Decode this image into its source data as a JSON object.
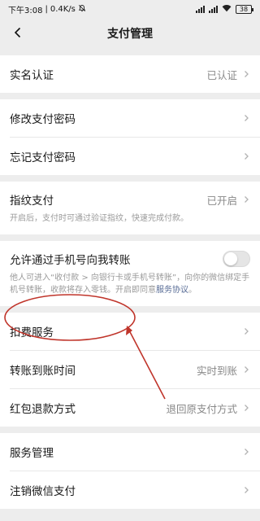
{
  "status_bar": {
    "time": "下午3:08",
    "net_speed": "0.4K/s",
    "battery": "38"
  },
  "nav": {
    "title": "支付管理"
  },
  "rows": {
    "real_name": {
      "label": "实名认证",
      "value": "已认证"
    },
    "change_pwd": {
      "label": "修改支付密码"
    },
    "forgot_pwd": {
      "label": "忘记支付密码"
    },
    "fingerprint": {
      "label": "指纹支付",
      "value": "已开启",
      "desc": "开启后，支付时可通过验证指纹，快速完成付款。"
    },
    "allow_transfer": {
      "label": "允许通过手机号向我转账",
      "desc": "他人可进入“收付款 > 向银行卡或手机号转账”，向你的微信绑定手机号转账，收款将存入零钱。开启即同意",
      "desc_link": "服务协议",
      "desc_end": "。",
      "enabled": false
    },
    "deduction": {
      "label": "扣费服务"
    },
    "arrival_time": {
      "label": "转账到账时间",
      "value": "实时到账"
    },
    "refund_method": {
      "label": "红包退款方式",
      "value": "退回原支付方式"
    },
    "service_mgmt": {
      "label": "服务管理"
    },
    "cancel_pay": {
      "label": "注销微信支付"
    }
  },
  "annotation": {
    "color": "#c0352b"
  }
}
